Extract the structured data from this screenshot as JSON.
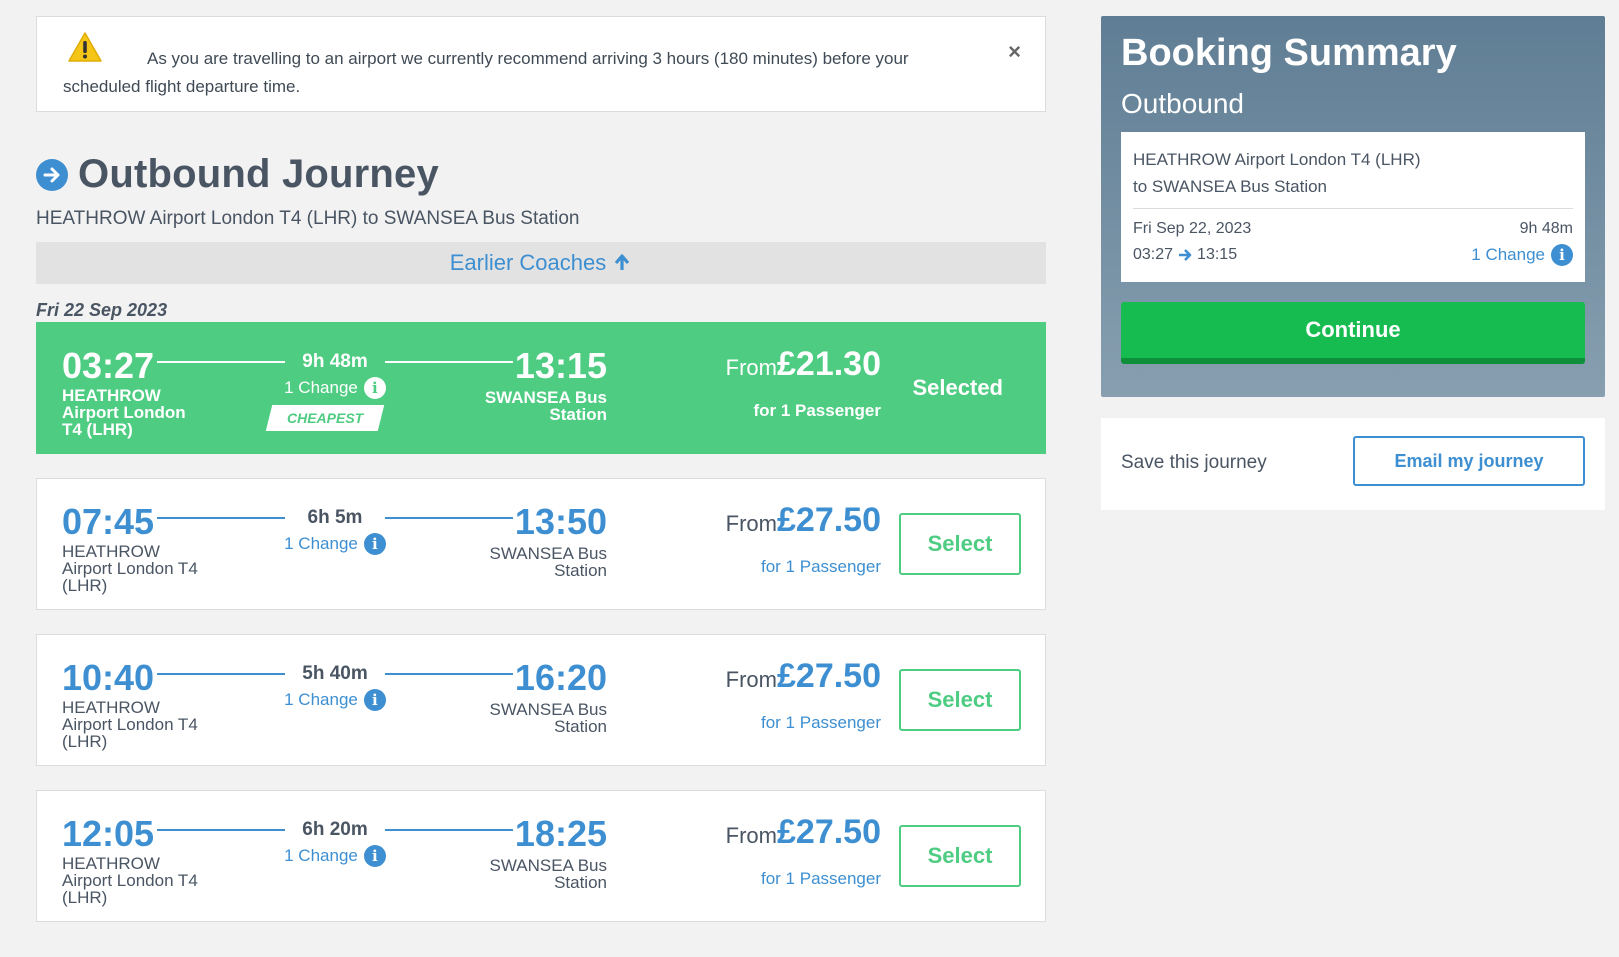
{
  "alert": {
    "message": "As you are travelling to an airport we currently recommend arriving 3 hours (180 minutes) before your scheduled flight departure time.",
    "close_label": "×"
  },
  "heading": {
    "title": "Outbound Journey",
    "route": "HEATHROW Airport London T4 (LHR) to SWANSEA Bus Station",
    "earlier_label": "Earlier Coaches",
    "date": "Fri 22 Sep 2023"
  },
  "journeys": [
    {
      "dep_time": "03:27",
      "arr_time": "13:15",
      "duration": "9h 48m",
      "changes": "1 Change",
      "dep_name": "HEATHROW Airport London T4 (LHR)",
      "arr_name": "SWANSEA Bus Station",
      "from_label": "From",
      "price": "£21.30",
      "passengers": "for 1 Passenger",
      "badge": "CHEAPEST",
      "action": "Selected",
      "selected": true
    },
    {
      "dep_time": "07:45",
      "arr_time": "13:50",
      "duration": "6h 5m",
      "changes": "1 Change",
      "dep_name": "HEATHROW Airport London T4 (LHR)",
      "arr_name": "SWANSEA Bus Station",
      "from_label": "From",
      "price": "£27.50",
      "passengers": "for 1 Passenger",
      "action": "Select",
      "selected": false
    },
    {
      "dep_time": "10:40",
      "arr_time": "16:20",
      "duration": "5h 40m",
      "changes": "1 Change",
      "dep_name": "HEATHROW Airport London T4 (LHR)",
      "arr_name": "SWANSEA Bus Station",
      "from_label": "From",
      "price": "£27.50",
      "passengers": "for 1 Passenger",
      "action": "Select",
      "selected": false
    },
    {
      "dep_time": "12:05",
      "arr_time": "18:25",
      "duration": "6h 20m",
      "changes": "1 Change",
      "dep_name": "HEATHROW Airport London T4 (LHR)",
      "arr_name": "SWANSEA Bus Station",
      "from_label": "From",
      "price": "£27.50",
      "passengers": "for 1 Passenger",
      "action": "Select",
      "selected": false
    }
  ],
  "summary": {
    "title": "Booking Summary",
    "outbound_label": "Outbound",
    "route_line1": "HEATHROW Airport London T4 (LHR)",
    "route_line2": "to SWANSEA Bus Station",
    "date": "Fri Sep 22, 2023",
    "duration": "9h 48m",
    "dep_time": "03:27",
    "arr_time": "13:15",
    "changes": "1 Change",
    "continue_label": "Continue"
  },
  "save": {
    "label": "Save this journey",
    "email_label": "Email my journey"
  },
  "colors": {
    "accent_blue": "#3d8fd1",
    "selected_green": "#4ecc82",
    "continue_green": "#16bc4f",
    "summary_bg": "#5f7d94"
  },
  "icons": [
    "warning-icon",
    "close-icon",
    "arrow-right-circle-icon",
    "arrow-up-icon",
    "info-icon",
    "arrow-right-icon"
  ]
}
